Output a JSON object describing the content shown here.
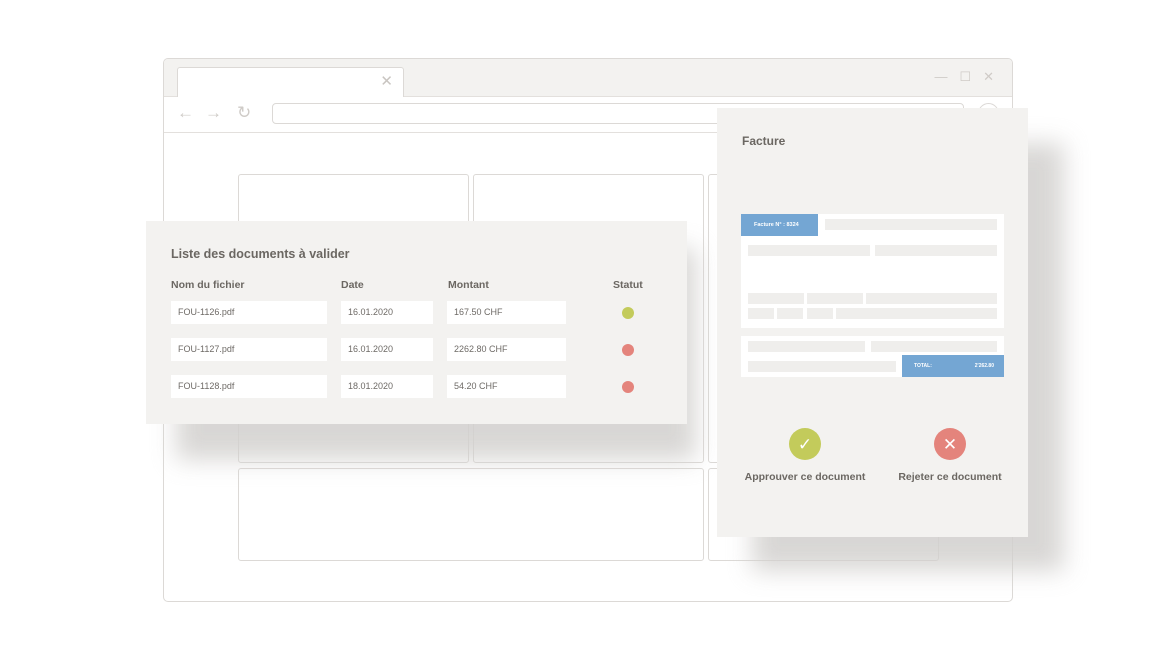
{
  "browser": {
    "tab_close": "✕",
    "window_controls": {
      "minimize": "—",
      "maximize": "☐",
      "close": "✕"
    },
    "nav": {
      "back": "←",
      "forward": "→",
      "reload": "↻"
    }
  },
  "list_panel": {
    "title": "Liste des documents à valider",
    "columns": {
      "file": "Nom du fichier",
      "date": "Date",
      "amount": "Montant",
      "status": "Statut"
    },
    "rows": [
      {
        "file": "FOU-1126.pdf",
        "date": "16.01.2020",
        "amount": "167.50 CHF",
        "status": "approved",
        "status_color": "#c3cb5b"
      },
      {
        "file": "FOU-1127.pdf",
        "date": "16.01.2020",
        "amount": "2262.80 CHF",
        "status": "pending",
        "status_color": "#e4847c"
      },
      {
        "file": "FOU-1128.pdf",
        "date": "18.01.2020",
        "amount": "54.20 CHF",
        "status": "pending",
        "status_color": "#e4847c"
      }
    ]
  },
  "invoice_panel": {
    "title": "Facture",
    "invoice_number_label": "Facture N° : 8324",
    "total_label": "TOTAL:",
    "total_value": "2'262.80",
    "approve_label": "Approuver ce document",
    "reject_label": "Rejeter ce document",
    "approve_icon": "✓",
    "reject_icon": "✕"
  },
  "colors": {
    "accent_blue": "#74a6d3",
    "approve_green": "#c3cb5b",
    "reject_red": "#e4847c",
    "panel_bg": "#f3f2f0"
  }
}
